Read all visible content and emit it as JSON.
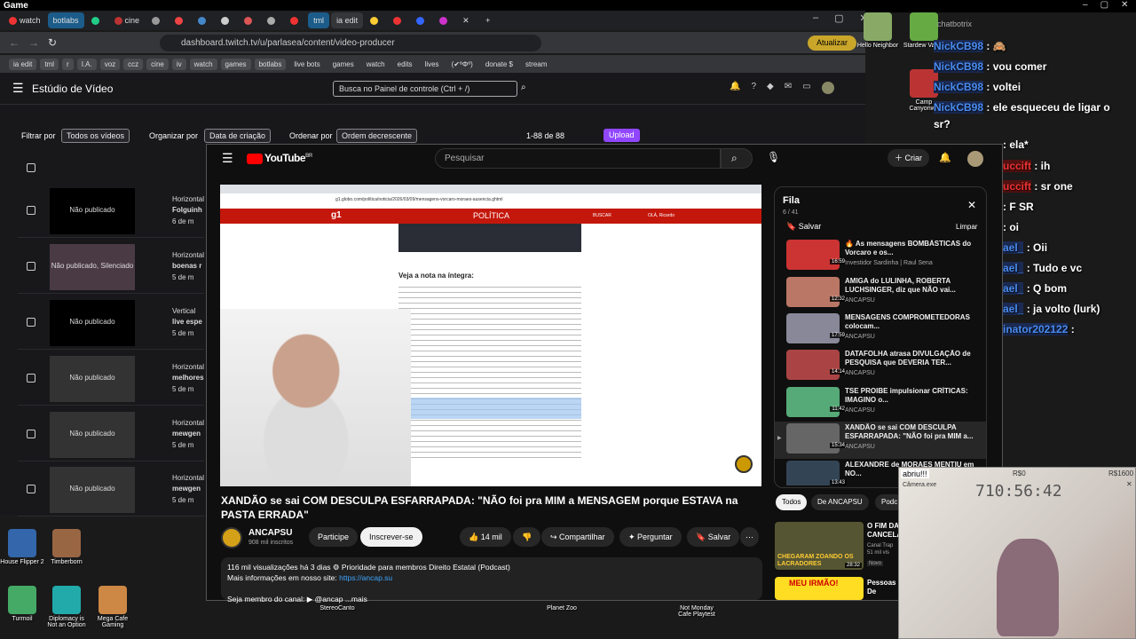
{
  "window": {
    "title": "Game"
  },
  "tabs": [
    "watch",
    "botlabs",
    "cine",
    "tml",
    "ia edit"
  ],
  "address": {
    "url": "dashboard.twitch.tv/u/parlasea/content/video-producer",
    "update_label": "Atualizar"
  },
  "bookmarks": [
    "ia edit",
    "tml",
    "r",
    "I.A.",
    "voz",
    "ccz",
    "cine",
    "iv",
    "watch",
    "games",
    "botlabs",
    "live bots",
    "games",
    "watch",
    "edits",
    "lives",
    "(✔ºΦº)",
    "donate $",
    "stream"
  ],
  "twitch": {
    "studio_title": "Estúdio de Vídeo",
    "search_placeholder": "Busca no Painel de controle (Ctrl + /)",
    "filter_label": "Filtrar por",
    "filter_value": "Todos os vídeos",
    "organize_label": "Organizar por",
    "organize_value": "Data de criação",
    "order_label": "Ordenar por",
    "order_value": "Ordem decrescente",
    "range": "1-88 de 88",
    "upload_label": "Upload",
    "rows": [
      {
        "thumb": "Não publicado",
        "type": "Horizontal",
        "title": "Folguinh",
        "age": "6 de m"
      },
      {
        "thumb": "Não publicado, Silenciado",
        "type": "Horizontal",
        "title": "boenas r",
        "age": "5 de m"
      },
      {
        "thumb": "Não publicado",
        "type": "Vertical",
        "title": "live espe",
        "age": "5 de m"
      },
      {
        "thumb": "Não publicado",
        "type": "Horizontal",
        "title": "melhores",
        "age": "5 de m"
      },
      {
        "thumb": "Não publicado",
        "type": "Horizontal",
        "title": "mewgen",
        "age": "5 de m"
      },
      {
        "thumb": "Não publicado",
        "type": "Horizontal",
        "title": "mewgen",
        "age": "5 de m"
      }
    ]
  },
  "youtube": {
    "logo": "YouTube",
    "logo_region": "BR",
    "search_placeholder": "Pesquisar",
    "create_label": "Criar",
    "video_title": "XANDÃO se sai COM DESCULPA ESFARRAPADA: \"NÃO foi pra MIM a MENSAGEM porque ESTAVA na PASTA ERRADA\"",
    "channel": "ANCAPSU",
    "subscribers": "908 mil inscritos",
    "join_label": "Participe",
    "subscribe_label": "Inscrever-se",
    "likes": "14 mil",
    "share_label": "Compartilhar",
    "ask_label": "Perguntar",
    "save_label": "Salvar",
    "desc_line1": "116 mil visualizações  há 3 dias  ⚙ Prioridade para membros  Direito Estatal (Podcast)",
    "desc_line2_prefix": "Mais informações em nosso site: ",
    "desc_link": "https://ancap.su",
    "desc_line3": "Seja membro do canal: ▶ @ancap ...mais",
    "article": {
      "section": "POLÍTICA",
      "heading": "Veja a nota na íntegra:",
      "search": "BUSCAR",
      "login": "OLÁ, Ricardo",
      "url": "g1.globo.com/politica/noticia/2026/03/09/mensagens-vorcaro-moraes-ausencia.ghtml"
    },
    "queue": {
      "title": "Fila",
      "count": "6 / 41",
      "save_label": "Salvar",
      "clear_label": "Limpar",
      "items": [
        {
          "title": "🔥 As mensagens BOMBÁSTICAS do Vorcaro e os...",
          "channel": "Investidor Sardinha | Raul Sena",
          "duration": "16:59",
          "color": "#c33"
        },
        {
          "title": "AMIGA do LULINHA, ROBERTA LUCHSINGER, diz que NÃO vai...",
          "channel": "ANCAPSU",
          "duration": "12:32",
          "color": "#b76"
        },
        {
          "title": "MENSAGENS COMPROMETEDORAS colocam...",
          "channel": "ANCAPSU",
          "duration": "17:59",
          "color": "#889"
        },
        {
          "title": "DATAFOLHA atrasa DIVULGAÇÃO de PESQUISA que DEVERIA TER...",
          "channel": "ANCAPSU",
          "duration": "14:14",
          "color": "#a44"
        },
        {
          "title": "TSE PROIBE impulsionar CRÍTICAS: IMAGINO o...",
          "channel": "ANCAPSU",
          "duration": "11:42",
          "color": "#5a7"
        },
        {
          "title": "XANDÃO se sai COM DESCULPA ESFARRAPADA: \"NÃO foi pra MIM a...",
          "channel": "ANCAPSU",
          "duration": "15:34",
          "color": "#666"
        },
        {
          "title": "ALEXANDRE de MORAES MENTIU em NO...",
          "channel": "",
          "duration": "13:43",
          "color": "#345"
        }
      ]
    },
    "chips": [
      "Todos",
      "De ANCAPSU",
      "Podc"
    ],
    "recs": [
      {
        "title": "O FIM DA CANCELA...",
        "channel": "Canal Trap",
        "meta": "51 mil vis",
        "badge": "Novo",
        "duration": "28:32",
        "caption": "CHEGARAM ZOANDO OS LACRADORES"
      },
      {
        "title": "Pessoas De Fazer...",
        "channel": "",
        "meta": "",
        "badge": "",
        "duration": "",
        "caption": "MEU IRMÃO!"
      }
    ]
  },
  "chat": {
    "header": "chatbotrix",
    "messages": [
      {
        "user": "NickCB98",
        "text": " : 🙈"
      },
      {
        "user": "NickCB98",
        "text": " : vou comer"
      },
      {
        "user": "NickCB98",
        "text": " : voltei"
      },
      {
        "user": "NickCB98",
        "text": " : ele esqueceu de ligar o"
      },
      {
        "user": "",
        "text": "sr?"
      },
      {
        "user": "",
        "text": " : ela*"
      },
      {
        "user": "uccift",
        "text": " : ih"
      },
      {
        "user": "uccift",
        "text": " : sr one"
      },
      {
        "user": "",
        "text": " : F SR"
      },
      {
        "user": "",
        "text": " : oi"
      },
      {
        "user": "ael_",
        "text": " : Oii"
      },
      {
        "user": "ael_",
        "text": " : Tudo e vc"
      },
      {
        "user": "ael_",
        "text": " : Q bom"
      },
      {
        "user": "ael_",
        "text": " : ja volto (lurk)"
      },
      {
        "user": "inator202122",
        "text": " :"
      }
    ]
  },
  "desktop_icons": [
    {
      "label": "Hello Neighbor",
      "color": "#8a6"
    },
    {
      "label": "Stardew Valley",
      "color": "#6a4"
    },
    {
      "label": "Camp Canyonwo",
      "color": "#b33"
    },
    {
      "label": "House Flipper 2",
      "color": "#36a"
    },
    {
      "label": "Timberborn",
      "color": "#964"
    },
    {
      "label": "Turmoil",
      "color": "#4a6"
    },
    {
      "label": "Diplomacy is Not an Option",
      "color": "#2aa"
    },
    {
      "label": "Mega Cafe Gaming",
      "color": "#c84"
    },
    {
      "label": "StereoCanto",
      "color": "#555"
    },
    {
      "label": "Planet Zoo",
      "color": "#385"
    },
    {
      "label": "Not Monday Cafe Playtest",
      "color": "#667"
    }
  ],
  "cam": {
    "label": "abriu!!!",
    "timer": "710:56:42",
    "money_left": "R$0",
    "money_right": "R$1600",
    "title": "Câmera.exe"
  }
}
